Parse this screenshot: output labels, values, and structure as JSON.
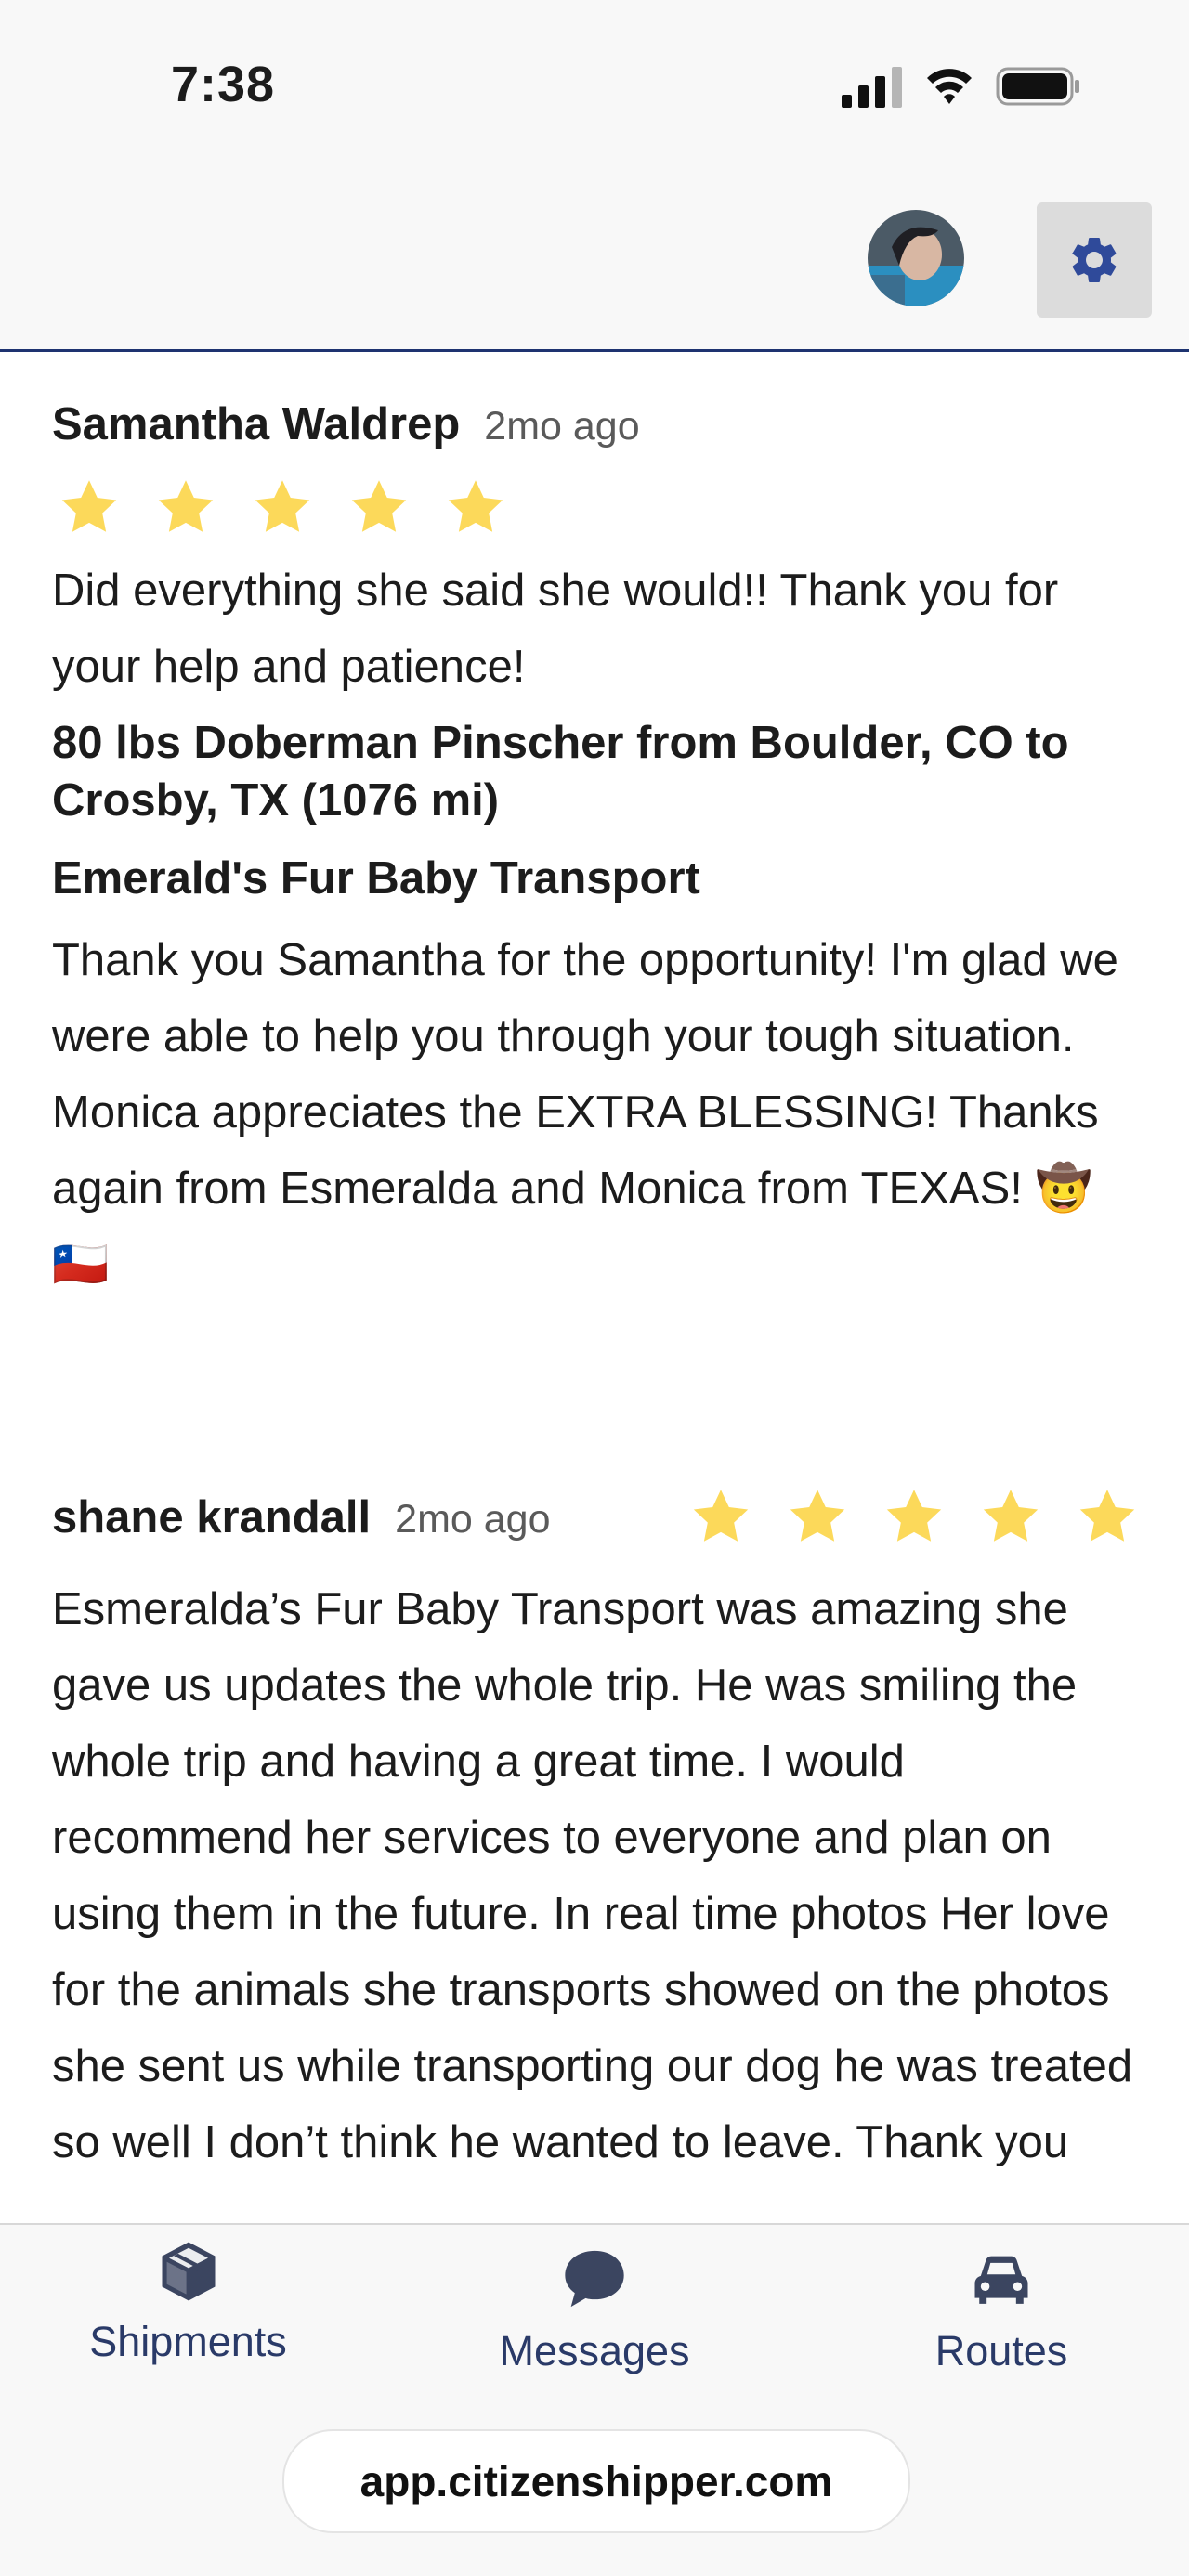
{
  "status_bar": {
    "time": "7:38"
  },
  "colors": {
    "accent": "#1e3370",
    "star": "#fcd95a",
    "settings_bg": "#dcdcdc"
  },
  "reviews": [
    {
      "name": "Samantha Waldrep",
      "date": "2mo ago",
      "rating": 5,
      "text": "Did everything she said she would!! Thank you for your help and patience!",
      "shipment": "80 lbs Doberman Pinscher from Boulder, CO to Crosby, TX (1076 mi)",
      "provider": "Emerald's Fur Baby Transport",
      "reply": "Thank you Samantha for the opportunity! I'm glad we were able to help you through your tough situation. Monica appreciates the EXTRA BLESSING! Thanks again from Esmeralda and Monica from TEXAS! 🤠🇨🇱"
    },
    {
      "name": "shane krandall",
      "date": "2mo ago",
      "rating": 5,
      "text": "Esmeralda’s Fur Baby Transport was amazing she gave us updates the whole trip. He was smiling the whole trip and having a great time. I would recommend her services to everyone and plan on using them in the future. In real time photos Her love for the animals she transports showed on the photos she sent us while transporting our dog he was treated so well I don’t think he wanted to leave. Thank you"
    }
  ],
  "nav": {
    "items": [
      {
        "label": "Shipments",
        "icon": "package-icon"
      },
      {
        "label": "Messages",
        "icon": "chat-bubble-icon"
      },
      {
        "label": "Routes",
        "icon": "car-icon"
      }
    ]
  },
  "browser": {
    "url": "app.citizenshipper.com"
  }
}
